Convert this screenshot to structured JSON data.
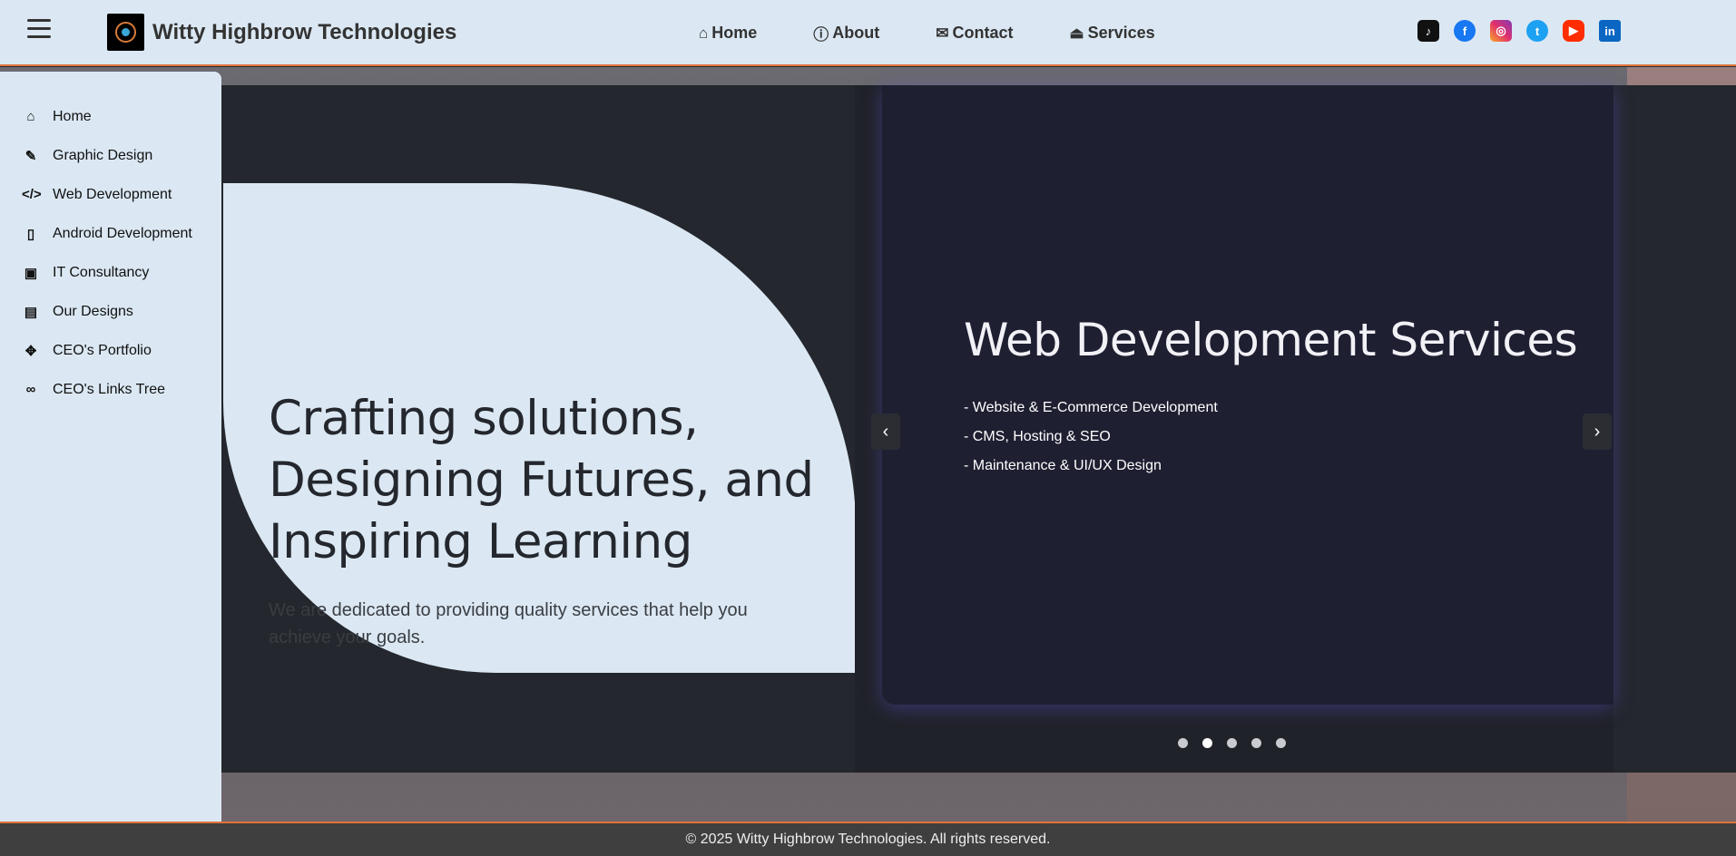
{
  "header": {
    "brand": "Witty Highbrow Technologies",
    "nav": [
      {
        "label": "Home",
        "icon": "home-icon"
      },
      {
        "label": "About",
        "icon": "info-icon"
      },
      {
        "label": "Contact",
        "icon": "envelope-icon"
      },
      {
        "label": "Services",
        "icon": "bell-icon"
      }
    ],
    "social": [
      {
        "name": "tiktok-icon",
        "color": "#111111"
      },
      {
        "name": "facebook-icon",
        "color": "#1877f2"
      },
      {
        "name": "instagram-icon",
        "color": "#e1306c"
      },
      {
        "name": "twitter-icon",
        "color": "#1da1f2"
      },
      {
        "name": "youtube-icon",
        "color": "#ff2d00"
      },
      {
        "name": "linkedin-icon",
        "color": "#0a66c2"
      }
    ]
  },
  "sidebar": {
    "items": [
      {
        "label": "Home",
        "icon": "home-icon"
      },
      {
        "label": "Graphic Design",
        "icon": "brush-icon"
      },
      {
        "label": "Web Development",
        "icon": "code-icon"
      },
      {
        "label": "Android Development",
        "icon": "mobile-icon"
      },
      {
        "label": "IT Consultancy",
        "icon": "briefcase-icon"
      },
      {
        "label": "Our Designs",
        "icon": "images-icon"
      },
      {
        "label": "CEO's Portfolio",
        "icon": "arrows-icon"
      },
      {
        "label": "CEO's Links Tree",
        "icon": "link-icon"
      }
    ]
  },
  "hero": {
    "title": "Crafting solutions, Designing Futures, and Inspiring Learning",
    "subtitle": "We are dedicated to providing quality services that help you achieve your goals."
  },
  "carousel": {
    "title": "Web Development Services",
    "items": [
      "- Website & E-Commerce Development",
      "- CMS, Hosting & SEO",
      "- Maintenance & UI/UX Design"
    ],
    "prev": "‹",
    "next": "›",
    "slide_count": 5,
    "active_slide": 2
  },
  "footer": {
    "text": "© 2025 Witty Highbrow Technologies. All rights reserved."
  },
  "colors": {
    "accent": "#e0733a",
    "header_bg": "#dbe8f3",
    "hero_bg": "#24272d",
    "slide_bg": "#1f1f32"
  }
}
